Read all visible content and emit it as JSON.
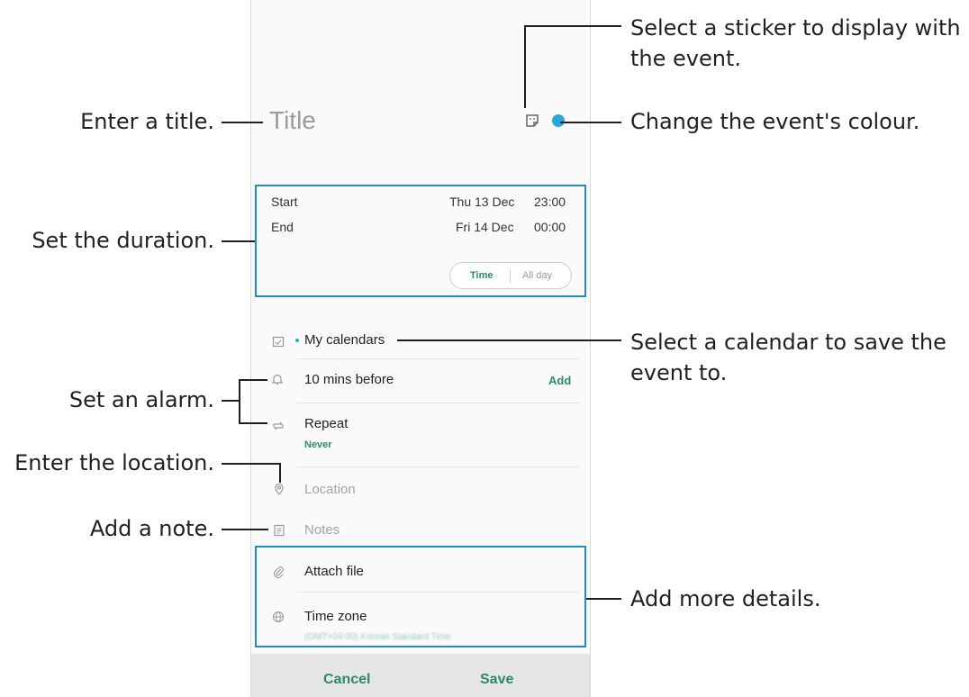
{
  "form": {
    "title_placeholder": "Title",
    "start_label": "Start",
    "start_date": "Thu 13 Dec",
    "start_time": "23:00",
    "end_label": "End",
    "end_date": "Fri 14 Dec",
    "end_time": "00:00",
    "toggle_time": "Time",
    "toggle_allday": "All day",
    "calendar": "My calendars",
    "alarm": "10 mins before",
    "alarm_add": "Add",
    "repeat": "Repeat",
    "repeat_value": "Never",
    "location_placeholder": "Location",
    "notes_placeholder": "Notes",
    "attach": "Attach file",
    "timezone": "Time zone",
    "timezone_value": "(GMT+09:00) Korean Standard Time",
    "cancel": "Cancel",
    "save": "Save",
    "event_color": "#2aa7de"
  },
  "annotations": {
    "sticker": [
      "Select a sticker to display with",
      "the event."
    ],
    "title": "Enter a title.",
    "colour": "Change the event's colour.",
    "duration": "Set the duration.",
    "calendar": [
      "Select a calendar to save the",
      "event to."
    ],
    "alarm": "Set an alarm.",
    "location": "Enter the location.",
    "note": "Add a note.",
    "details": "Add more details."
  },
  "colors": {
    "accent_green": "#2b8a6a",
    "highlight_box": "#1f8fc7",
    "text": "#231f20"
  },
  "icons": [
    "sticker-icon",
    "color-dot-icon",
    "calendar-icon",
    "bell-icon",
    "repeat-icon",
    "location-icon",
    "notes-icon",
    "paperclip-icon",
    "globe-icon"
  ]
}
